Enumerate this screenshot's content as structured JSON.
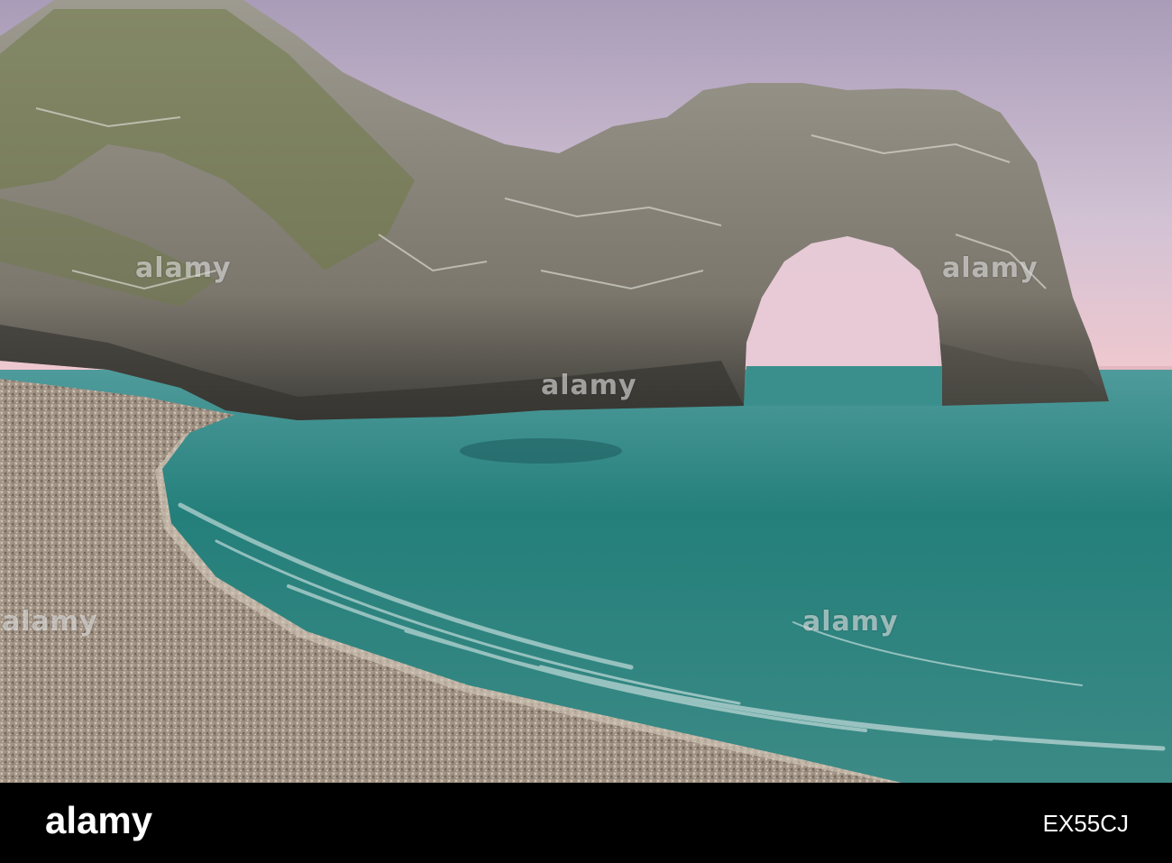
{
  "image": {
    "subject": "Durdle Door",
    "scene": "limestone sea arch with shingle beach and turquoise water at dusk",
    "colors": {
      "sky_top": "#b9adc6",
      "sky_horizon": "#e8c9d3",
      "sea": "#2f8f8a",
      "rock": "#8f8c82",
      "beach": "#a89a8a"
    }
  },
  "watermark": {
    "text": "alamy"
  },
  "footer": {
    "brand": "alamy",
    "image_code": "EX55CJ"
  }
}
